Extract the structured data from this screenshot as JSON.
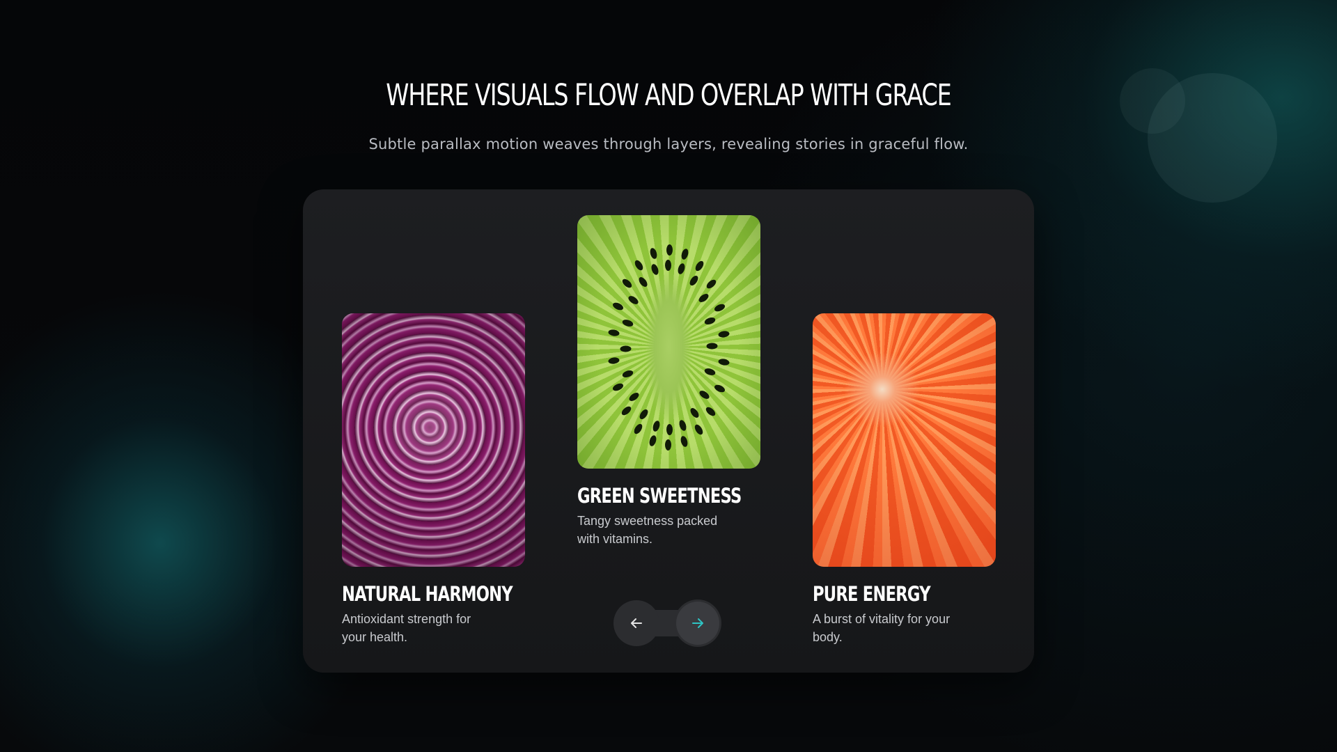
{
  "section": {
    "title": "WHERE VISUALS FLOW AND OVERLAP WITH GRACE",
    "subtitle": "Subtle parallax motion weaves through layers, revealing stories in graceful flow."
  },
  "cards": [
    {
      "title": "NATURAL HARMONY",
      "description": "Antioxidant strength for your health.",
      "image": "red-cabbage-closeup"
    },
    {
      "title": "GREEN SWEETNESS",
      "description": "Tangy sweetness packed with vitamins.",
      "image": "kiwi-slice-closeup"
    },
    {
      "title": "PURE ENERGY",
      "description": "A burst of vitality for your body.",
      "image": "grapefruit-closeup"
    }
  ],
  "navigation": {
    "prev_icon": "arrow-left-icon",
    "next_icon": "arrow-right-icon",
    "next_color": "#2ec4c4",
    "prev_color": "#e6e6e6"
  },
  "colors": {
    "background": "#060709",
    "panel": "#1b1c1f",
    "accent": "#2ec4c4"
  }
}
